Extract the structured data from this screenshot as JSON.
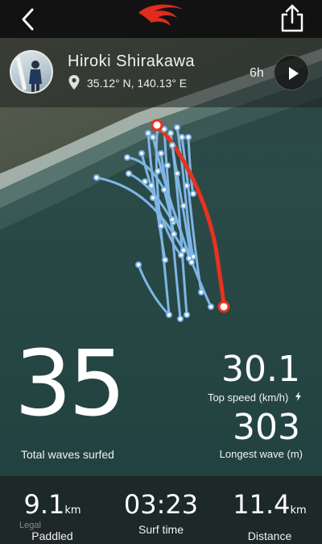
{
  "header": {
    "back_icon": "chevron-left-icon",
    "logo_icon": "ripcurl-logo-icon",
    "share_icon": "share-icon",
    "brand_color": "#e02b1e"
  },
  "profile": {
    "name": "Hiroki Shirakawa",
    "coordinates": "35.12° N, 140.13° E",
    "duration": "6h",
    "location_icon": "location-pin-icon",
    "play_icon": "play-icon"
  },
  "stats": {
    "waves": "35",
    "waves_label": "Total waves surfed",
    "top_speed": "30.1",
    "top_speed_label": "Top speed (km/h)",
    "top_speed_icon": "lightning-icon",
    "longest_wave": "303",
    "longest_wave_label": "Longest wave (m)"
  },
  "summary": {
    "paddled_value": "9.1",
    "paddled_unit": "km",
    "paddled_label": "Paddled",
    "surf_time_value": "03:23",
    "surf_time_label": "Surf time",
    "distance_value": "11.4",
    "distance_unit": "km",
    "distance_label": "Distance"
  },
  "map": {
    "legal_label": "Legal",
    "track_color": "#7fb6e6",
    "highlight_color": "#e8321e"
  }
}
